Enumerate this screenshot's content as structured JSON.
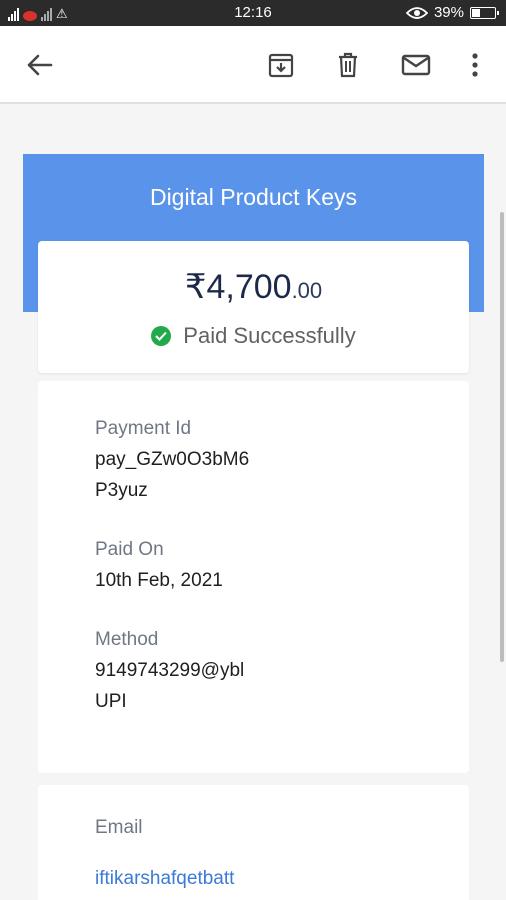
{
  "status_bar": {
    "time": "12:16",
    "battery_percent": "39%",
    "battery_level": 0.39
  },
  "toolbar": {
    "icons": [
      "back-arrow-icon",
      "archive-icon",
      "trash-icon",
      "mail-icon",
      "more-vert-icon"
    ]
  },
  "receipt": {
    "title": "Digital Product Keys",
    "amount_main": "₹4,700",
    "amount_decimal": ".00",
    "status": "Paid Successfully",
    "payment_id_label": "Payment Id",
    "payment_id_line1": "pay_GZw0O3bM6",
    "payment_id_line2": "P3yuz",
    "paid_on_label": "Paid On",
    "paid_on_value": "10th Feb, 2021",
    "method_label": "Method",
    "method_line1": "9149743299@ybl",
    "method_line2": "UPI",
    "email_label": "Email",
    "email_value": "iftikarshafqetbatt"
  },
  "colors": {
    "header": "#5a93ea",
    "success": "#22a94b",
    "link": "#3b7ad8",
    "amount": "#1c2a4a"
  }
}
